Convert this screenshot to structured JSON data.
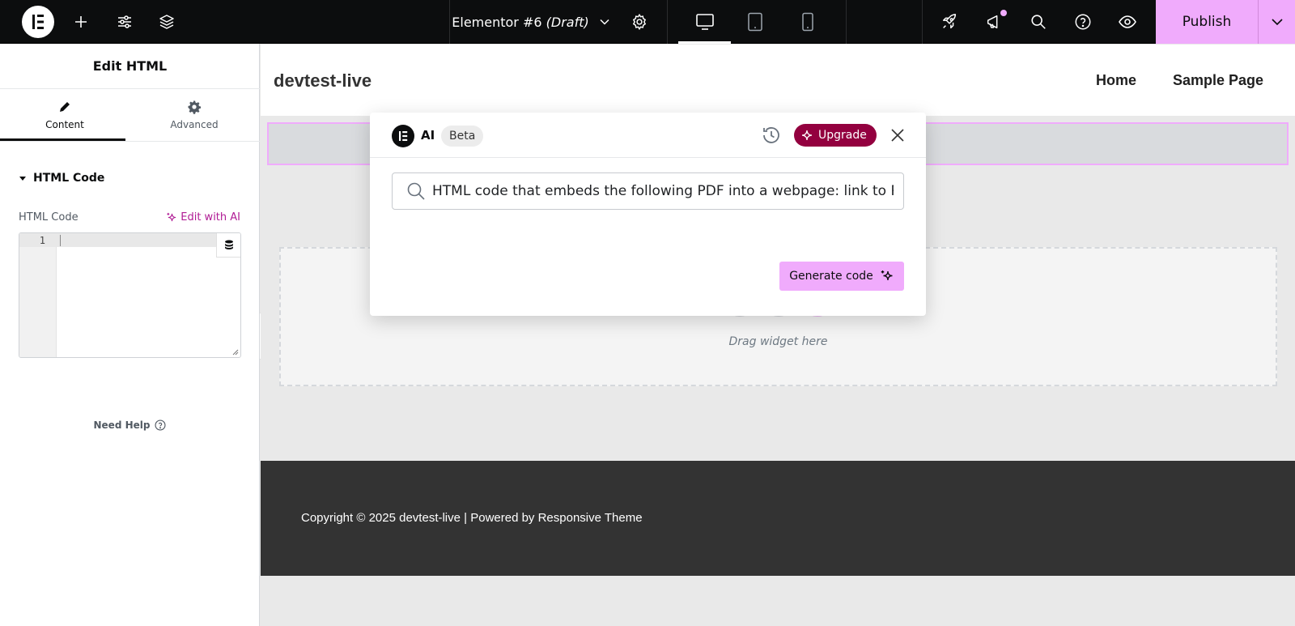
{
  "topbar": {
    "document_title": "Elementor #6",
    "document_status": "(Draft)",
    "publish_label": "Publish"
  },
  "panel": {
    "title": "Edit HTML",
    "tabs": [
      {
        "label": "Content",
        "icon": "pencil-icon",
        "active": true
      },
      {
        "label": "Advanced",
        "icon": "gear-icon",
        "active": false
      }
    ],
    "section_title": "HTML Code",
    "field_label": "HTML Code",
    "edit_with_ai_label": "Edit with AI",
    "code_line_number": "1",
    "code_value": "",
    "need_help_label": "Need Help"
  },
  "canvas": {
    "site_title": "devtest-live",
    "nav": [
      "Home",
      "Sample Page"
    ],
    "drop_text": "Drag widget here",
    "footer_text": "Copyright © 2025 devtest-live | Powered by Responsive Theme"
  },
  "ai_modal": {
    "title": "AI",
    "badge": "Beta",
    "upgrade_label": "Upgrade",
    "prompt_value": "HTML code that embeds the following PDF into a webpage: link to P",
    "generate_label": "Generate code"
  },
  "colors": {
    "accent_pink": "#f0abfc",
    "upgrade_bg": "#93003f",
    "ai_link": "#b01b94",
    "topbar_bg": "#0c0d0e"
  }
}
